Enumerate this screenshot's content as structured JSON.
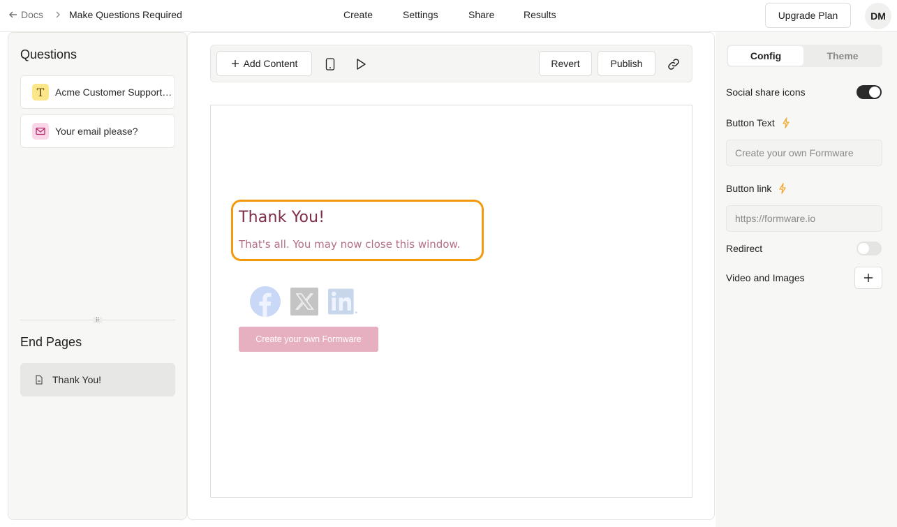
{
  "header": {
    "back_label": "Docs",
    "page_title": "Make Questions Required",
    "nav": [
      "Create",
      "Settings",
      "Share",
      "Results"
    ],
    "upgrade_label": "Upgrade Plan",
    "avatar_initials": "DM"
  },
  "sidebar": {
    "questions_title": "Questions",
    "questions": [
      {
        "label": "Acme Customer Support Survey",
        "type_icon": "text-type-icon"
      },
      {
        "label": "Your email please?",
        "type_icon": "email-icon"
      }
    ],
    "end_pages_title": "End Pages",
    "end_pages": [
      {
        "label": "Thank You!",
        "type_icon": "document-icon"
      }
    ]
  },
  "toolbar": {
    "add_content_label": "Add Content",
    "revert_label": "Revert",
    "publish_label": "Publish"
  },
  "preview": {
    "title": "Thank You!",
    "subtitle": "That's all. You may now close this window.",
    "social_icons": [
      "facebook-icon",
      "x-icon",
      "linkedin-icon"
    ],
    "button_text": "Create your own Formware"
  },
  "config": {
    "tabs": [
      "Config",
      "Theme"
    ],
    "active_tab": "Config",
    "social_share_label": "Social share icons",
    "social_share_on": true,
    "button_text_label": "Button Text",
    "button_text_placeholder": "Create your own Formware",
    "button_link_label": "Button link",
    "button_link_placeholder": "https://formware.io",
    "redirect_label": "Redirect",
    "redirect_on": false,
    "video_images_label": "Video and Images"
  },
  "colors": {
    "accent_highlight": "#f29a0b",
    "preview_title": "#7d2d4a",
    "preview_subtitle": "#b46d87",
    "cta_background": "#e6b0c0"
  }
}
